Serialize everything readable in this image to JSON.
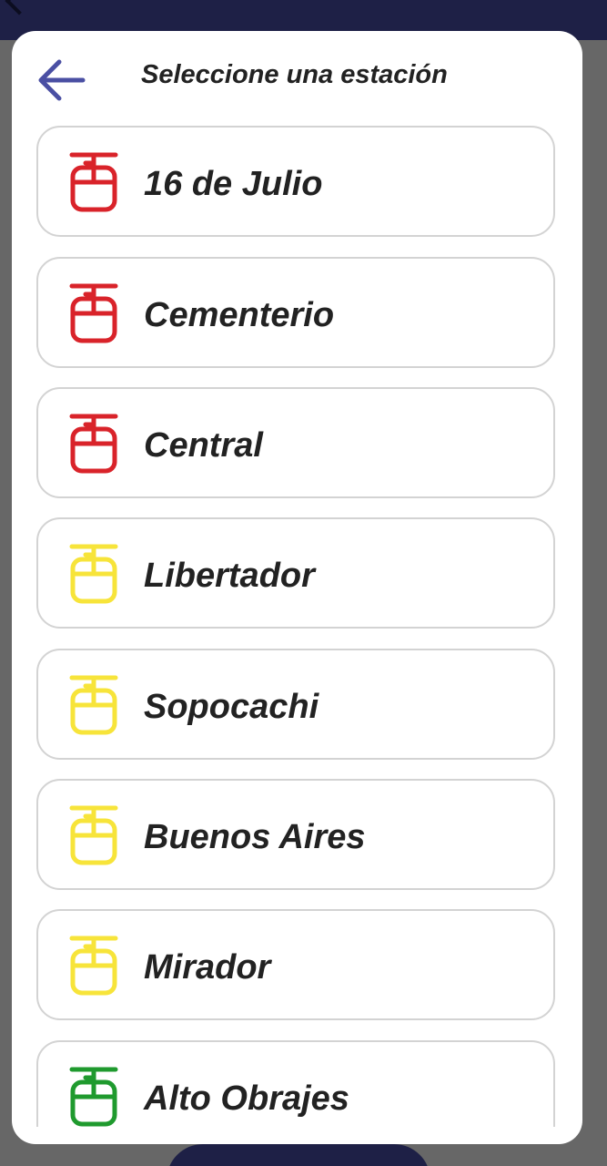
{
  "dialog": {
    "title": "Seleccione una estación",
    "back_icon": "arrow-left-icon",
    "accent_color": "#4a4fa3"
  },
  "line_colors": {
    "roja": "#d9232a",
    "amarilla": "#f7e43a",
    "verde": "#1f9a2e"
  },
  "stations": [
    {
      "label": "16 de Julio",
      "line": "roja",
      "icon": "cable-car-icon"
    },
    {
      "label": "Cementerio",
      "line": "roja",
      "icon": "cable-car-icon"
    },
    {
      "label": "Central",
      "line": "roja",
      "icon": "cable-car-icon"
    },
    {
      "label": "Libertador",
      "line": "amarilla",
      "icon": "cable-car-icon"
    },
    {
      "label": "Sopocachi",
      "line": "amarilla",
      "icon": "cable-car-icon"
    },
    {
      "label": "Buenos Aires",
      "line": "amarilla",
      "icon": "cable-car-icon"
    },
    {
      "label": "Mirador",
      "line": "amarilla",
      "icon": "cable-car-icon"
    },
    {
      "label": "Alto Obrajes",
      "line": "verde",
      "icon": "cable-car-icon"
    }
  ]
}
